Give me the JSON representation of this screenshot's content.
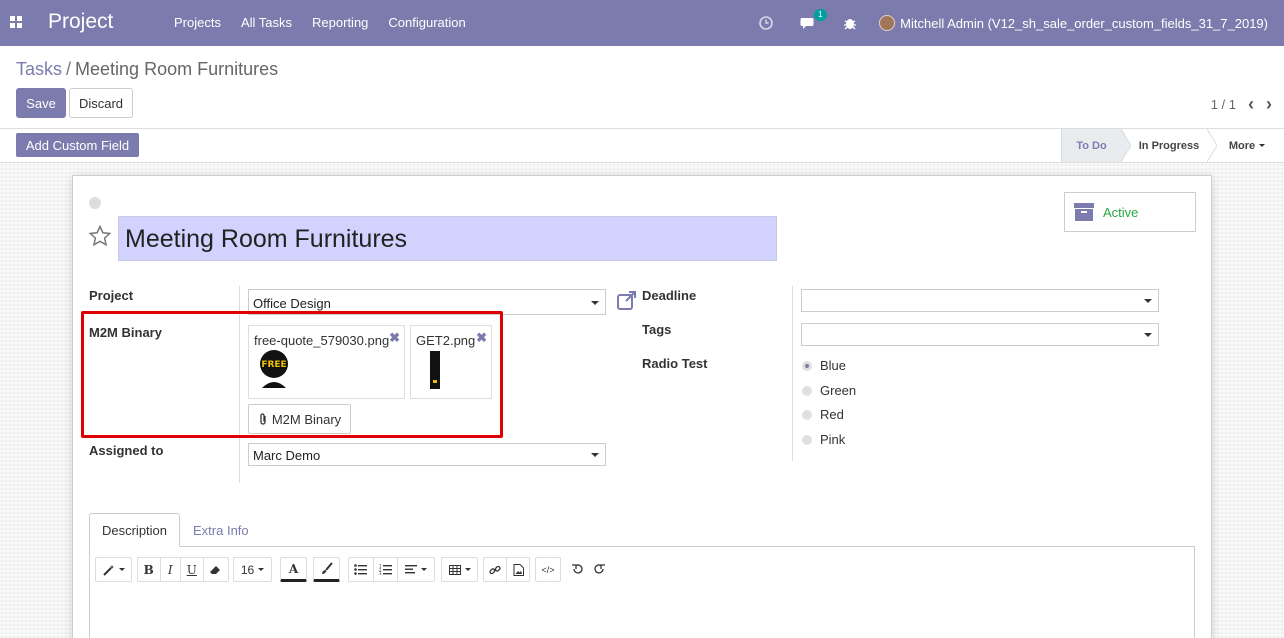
{
  "navbar": {
    "brand": "Project",
    "menu": [
      "Projects",
      "All Tasks",
      "Reporting",
      "Configuration"
    ],
    "chat_badge": "1",
    "user_name": "Mitchell Admin (V12_sh_sale_order_custom_fields_31_7_2019)",
    "color": "#7c7bad"
  },
  "breadcrumb": {
    "parent": "Tasks",
    "separator": "/",
    "current": "Meeting Room Furnitures"
  },
  "buttons": {
    "save": "Save",
    "discard": "Discard",
    "add_custom_field": "Add Custom Field"
  },
  "pager": {
    "value": "1 / 1"
  },
  "statusbar": {
    "stages": [
      "To Do",
      "In Progress"
    ],
    "current_stage": "To Do",
    "more": "More"
  },
  "form": {
    "title": "Meeting Room Furnitures",
    "active_label": "Active",
    "project": {
      "label": "Project",
      "value": "Office Design"
    },
    "m2m": {
      "label": "M2M Binary",
      "files": [
        "free-quote_579030.png",
        "GET2.png"
      ],
      "upload_label": "M2M Binary"
    },
    "assigned": {
      "label": "Assigned to",
      "value": "Marc Demo"
    },
    "deadline": {
      "label": "Deadline",
      "value": ""
    },
    "tags": {
      "label": "Tags",
      "value": ""
    },
    "radio": {
      "label": "Radio Test",
      "options": [
        "Blue",
        "Green",
        "Red",
        "Pink"
      ],
      "selected": "Blue"
    }
  },
  "tabs": [
    "Description",
    "Extra Info"
  ],
  "editor": {
    "font_size": "16"
  }
}
